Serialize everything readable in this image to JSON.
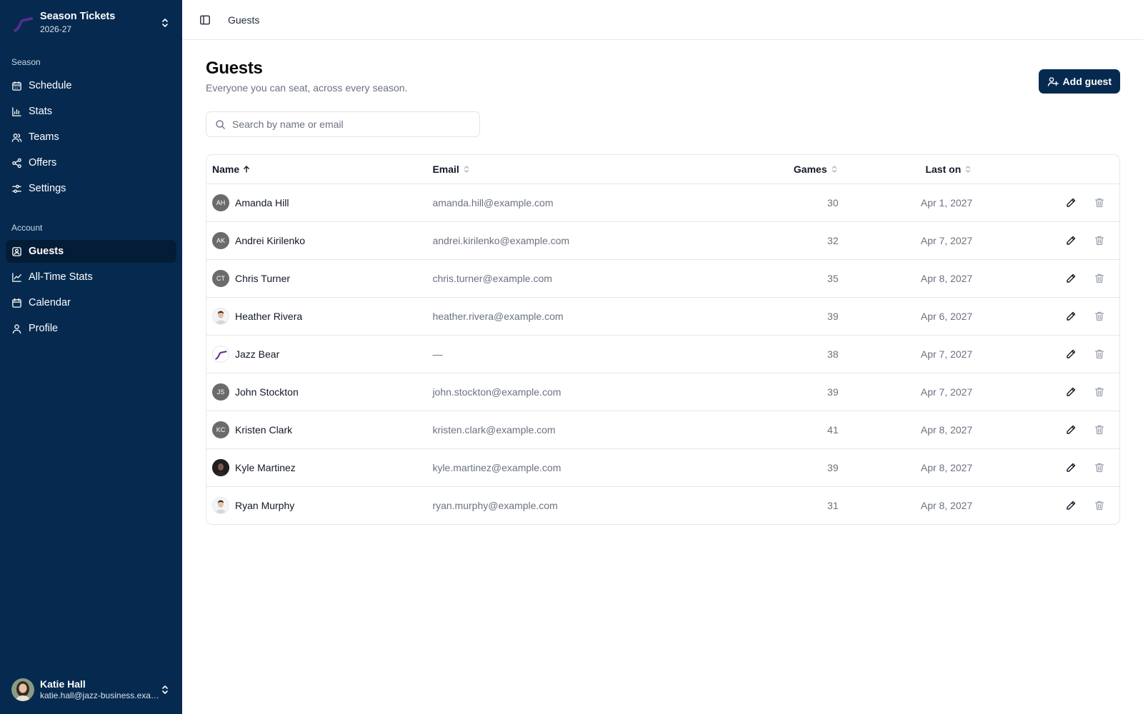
{
  "app": {
    "name": "Season Tickets",
    "season": "2026-27"
  },
  "sidebar": {
    "groups": [
      {
        "label": "Season",
        "items": [
          {
            "label": "Schedule",
            "icon": "calendar-grid-icon"
          },
          {
            "label": "Stats",
            "icon": "bar-chart-icon"
          },
          {
            "label": "Teams",
            "icon": "users-icon"
          },
          {
            "label": "Offers",
            "icon": "share-icon"
          },
          {
            "label": "Settings",
            "icon": "sliders-icon"
          }
        ]
      },
      {
        "label": "Account",
        "items": [
          {
            "label": "Guests",
            "icon": "contact-icon",
            "active": true
          },
          {
            "label": "All-Time Stats",
            "icon": "line-chart-icon"
          },
          {
            "label": "Calendar",
            "icon": "calendar-icon"
          },
          {
            "label": "Profile",
            "icon": "user-icon"
          }
        ]
      }
    ],
    "user": {
      "name": "Katie Hall",
      "email": "katie.hall@jazz-business.example.com"
    }
  },
  "topbar": {
    "breadcrumb": "Guests"
  },
  "page": {
    "title": "Guests",
    "subtitle": "Everyone you can seat, across every season.",
    "add_button": "Add guest",
    "search_placeholder": "Search by name or email"
  },
  "table": {
    "columns": {
      "name": "Name",
      "email": "Email",
      "games": "Games",
      "last_on": "Last on"
    },
    "rows": [
      {
        "initials": "AH",
        "avatar": "initials",
        "name": "Amanda Hill",
        "email": "amanda.hill@example.com",
        "games": "30",
        "last_on": "Apr 1, 2027"
      },
      {
        "initials": "AK",
        "avatar": "initials",
        "name": "Andrei Kirilenko",
        "email": "andrei.kirilenko@example.com",
        "games": "32",
        "last_on": "Apr 7, 2027"
      },
      {
        "initials": "CT",
        "avatar": "initials",
        "name": "Chris Turner",
        "email": "chris.turner@example.com",
        "games": "35",
        "last_on": "Apr 8, 2027"
      },
      {
        "initials": "",
        "avatar": "photo-light",
        "name": "Heather Rivera",
        "email": "heather.rivera@example.com",
        "games": "39",
        "last_on": "Apr 6, 2027"
      },
      {
        "initials": "",
        "avatar": "logo",
        "name": "Jazz Bear",
        "email": "—",
        "games": "38",
        "last_on": "Apr 7, 2027"
      },
      {
        "initials": "JS",
        "avatar": "initials",
        "name": "John Stockton",
        "email": "john.stockton@example.com",
        "games": "39",
        "last_on": "Apr 7, 2027"
      },
      {
        "initials": "KC",
        "avatar": "initials",
        "name": "Kristen Clark",
        "email": "kristen.clark@example.com",
        "games": "41",
        "last_on": "Apr 8, 2027"
      },
      {
        "initials": "",
        "avatar": "photo-dark",
        "name": "Kyle Martinez",
        "email": "kyle.martinez@example.com",
        "games": "39",
        "last_on": "Apr 8, 2027"
      },
      {
        "initials": "",
        "avatar": "photo-light",
        "name": "Ryan Murphy",
        "email": "ryan.murphy@example.com",
        "games": "31",
        "last_on": "Apr 8, 2027"
      }
    ]
  },
  "colors": {
    "sidebar_bg": "#062a4f",
    "sidebar_active": "#041c35",
    "accent": "#062a4f",
    "brand_purple": "#5b2d90"
  }
}
